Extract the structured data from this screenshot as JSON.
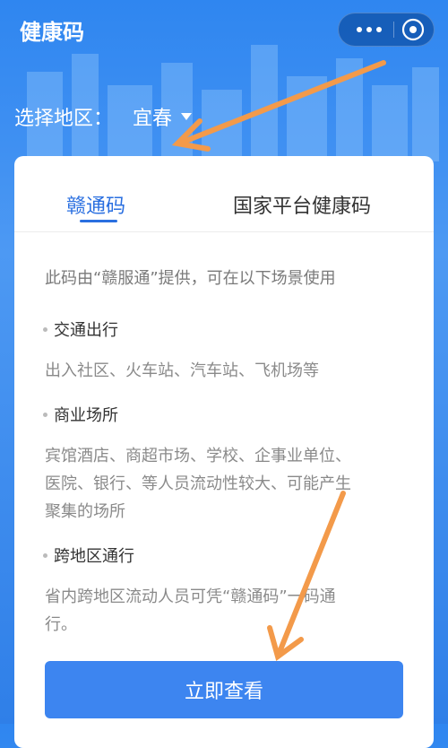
{
  "header": {
    "title": "健康码"
  },
  "region": {
    "label": "选择地区：",
    "city": "宜春"
  },
  "tabs": [
    {
      "label": "赣通码"
    },
    {
      "label": "国家平台健康码"
    }
  ],
  "intro": "此码由“赣服通”提供，可在以下场景使用",
  "sections": [
    {
      "title": "交通出行",
      "lines": [
        "出入社区、火车站、汽车站、飞机场等"
      ]
    },
    {
      "title": "商业场所",
      "lines": [
        "宾馆酒店、商超市场、学校、企事业单位、",
        "医院、银行、等人员流动性较大、可能产生",
        "聚集的场所"
      ]
    },
    {
      "title": "跨地区通行",
      "lines": [
        "省内跨地区流动人员可凭“赣通码”一码通",
        "行。"
      ]
    }
  ],
  "cta": {
    "label": "立即查看"
  },
  "colors": {
    "brand_blue": "#3d85f0",
    "annotation_orange": "#f39a4a"
  }
}
